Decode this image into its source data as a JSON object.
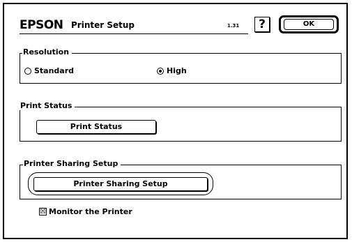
{
  "header": {
    "brand": "EPSON",
    "title": "Printer Setup",
    "version": "1.31",
    "help_label": "?",
    "ok_label": "OK"
  },
  "resolution": {
    "label": "Resolution",
    "options": [
      {
        "label": "Standard",
        "selected": false
      },
      {
        "label": "High",
        "selected": true
      }
    ]
  },
  "print_status": {
    "label": "Print Status",
    "button_label": "Print Status"
  },
  "sharing": {
    "label": "Printer Sharing Setup",
    "button_label": "Printer Sharing Setup"
  },
  "monitor": {
    "label": "Monitor the Printer",
    "checked": true,
    "check_glyph": "☒"
  }
}
